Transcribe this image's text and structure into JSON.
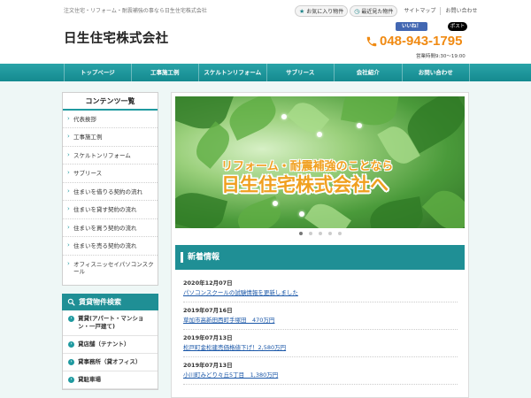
{
  "header": {
    "tagline": "注文住宅・リフォーム・耐震補強の事なら日生住宅株式会社",
    "site_title": "日生住宅株式会社",
    "favorites_label": "お気に入り物件",
    "recent_label": "最近見た物件",
    "sitemap_label": "サイトマップ",
    "contact_label": "お問い合わせ",
    "like_label": "いいね！",
    "post_label": "ポスト",
    "phone": "048-943-1795",
    "hours": "営業時間9:30～19:00"
  },
  "nav": {
    "items": [
      "トップページ",
      "工事施工例",
      "スケルトンリフォーム",
      "サブリース",
      "会社紹介",
      "お問い合わせ"
    ]
  },
  "sidebar": {
    "title": "コンテンツ一覧",
    "items": [
      "代表挨拶",
      "工事施工例",
      "スケルトンリフォーム",
      "サブリース",
      "住まいを借りる契約の流れ",
      "住まいを貸す契約の流れ",
      "住まいを買う契約の流れ",
      "住まいを売る契約の流れ",
      "オフィスニッセイパソコンスクール"
    ],
    "rent_title": "賃貸物件検索",
    "rent_items": [
      "賃貸(アパート・マンション・一戸建て)",
      "貸店舗（テナント）",
      "貸事務所（貸オフィス）",
      "貸駐車場"
    ]
  },
  "slider": {
    "line1": "リフォーム・耐震補強のことなら",
    "line2": "日生住宅株式会社へ",
    "active_index": 0,
    "count": 5
  },
  "news": {
    "title": "新着情報",
    "items": [
      {
        "date": "2020年12月07日",
        "text": "パソコンスクールの試験情報を更新しました"
      },
      {
        "date": "2019年07月16日",
        "text": "草加市高新田西町手塚田　470万円"
      },
      {
        "date": "2019年07月13日",
        "text": "松戸町金松建売価格値下げ！2,580万円"
      },
      {
        "date": "2019年07月13日",
        "text": "小川町みどり々丘5丁目　1,380万円"
      }
    ]
  },
  "colors": {
    "accent": "#1f8f95",
    "phone": "#f08a12",
    "link": "#1a57a8"
  }
}
